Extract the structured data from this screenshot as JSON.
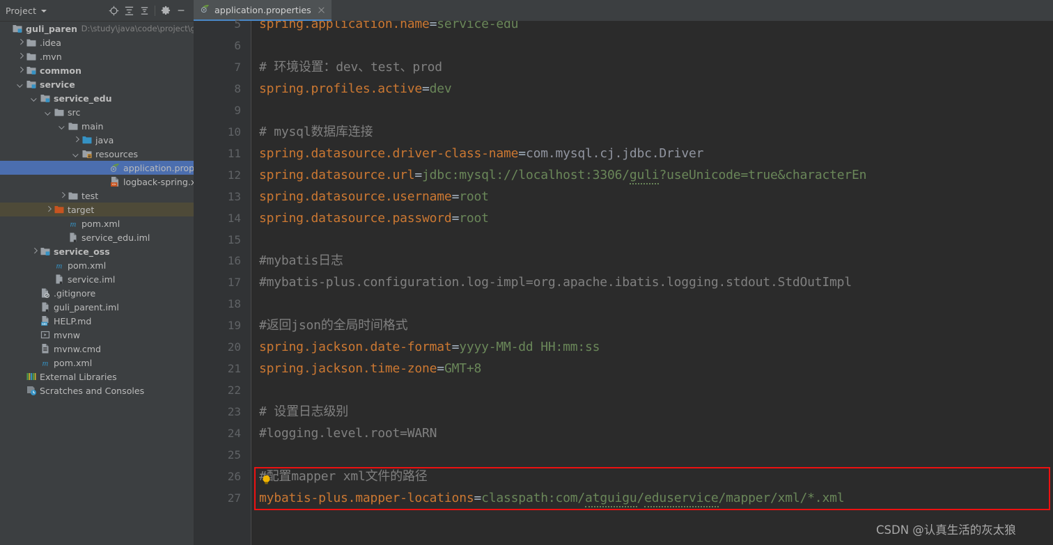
{
  "window": {
    "theme_colors": {
      "sidebar_bg": "#3c3f41",
      "editor_bg": "#2b2b2b",
      "gutter_bg": "#313335",
      "selection_blue": "#4b6eaf",
      "highlight_olive": "#4e4a38",
      "tab_active_bg": "#4e5254",
      "tab_underline": "#4a88c7",
      "key_orange": "#cc7832",
      "value_green": "#6a8759",
      "comment_gray": "#808080",
      "class_gray": "#9195a0",
      "annotation_red": "#ee1111"
    }
  },
  "project_panel": {
    "title": "Project",
    "toolbar_icons": [
      {
        "name": "scroll-from-source-icon",
        "glyph": "target"
      },
      {
        "name": "expand-all-icon",
        "glyph": "expand"
      },
      {
        "name": "collapse-all-icon",
        "glyph": "collapse"
      },
      {
        "name": "settings-gear-icon",
        "glyph": "gear"
      },
      {
        "name": "hide-panel-icon",
        "glyph": "minus"
      }
    ],
    "tree": [
      {
        "label": "guli_parent",
        "sub": "D:\\study\\java\\code\\project\\guli",
        "indent": 0,
        "arrow": "none",
        "icon": "module",
        "bold": true,
        "state": "none"
      },
      {
        "label": ".idea",
        "sub": "",
        "indent": 1,
        "arrow": "right",
        "icon": "folder",
        "bold": false,
        "state": "none"
      },
      {
        "label": ".mvn",
        "sub": "",
        "indent": 1,
        "arrow": "right",
        "icon": "folder",
        "bold": false,
        "state": "none"
      },
      {
        "label": "common",
        "sub": "",
        "indent": 1,
        "arrow": "right",
        "icon": "module",
        "bold": true,
        "state": "none"
      },
      {
        "label": "service",
        "sub": "",
        "indent": 1,
        "arrow": "down",
        "icon": "module",
        "bold": true,
        "state": "none"
      },
      {
        "label": "service_edu",
        "sub": "",
        "indent": 2,
        "arrow": "down",
        "icon": "module",
        "bold": true,
        "state": "none"
      },
      {
        "label": "src",
        "sub": "",
        "indent": 3,
        "arrow": "down",
        "icon": "folder",
        "bold": false,
        "state": "none"
      },
      {
        "label": "main",
        "sub": "",
        "indent": 4,
        "arrow": "down",
        "icon": "folder",
        "bold": false,
        "state": "none"
      },
      {
        "label": "java",
        "sub": "",
        "indent": 5,
        "arrow": "right",
        "icon": "sources",
        "bold": false,
        "state": "none"
      },
      {
        "label": "resources",
        "sub": "",
        "indent": 5,
        "arrow": "down",
        "icon": "resources",
        "bold": false,
        "state": "none"
      },
      {
        "label": "application.properties",
        "sub": "",
        "indent": 7,
        "arrow": "none",
        "icon": "spring",
        "bold": false,
        "state": "selected"
      },
      {
        "label": "logback-spring.xml",
        "sub": "",
        "indent": 7,
        "arrow": "none",
        "icon": "xml",
        "bold": false,
        "state": "none"
      },
      {
        "label": "test",
        "sub": "",
        "indent": 4,
        "arrow": "right",
        "icon": "folder",
        "bold": false,
        "state": "none"
      },
      {
        "label": "target",
        "sub": "",
        "indent": 3,
        "arrow": "right",
        "icon": "target",
        "bold": false,
        "state": "highlighted"
      },
      {
        "label": "pom.xml",
        "sub": "",
        "indent": 4,
        "arrow": "none",
        "icon": "maven",
        "bold": false,
        "state": "none"
      },
      {
        "label": "service_edu.iml",
        "sub": "",
        "indent": 4,
        "arrow": "none",
        "icon": "iml",
        "bold": false,
        "state": "none"
      },
      {
        "label": "service_oss",
        "sub": "",
        "indent": 2,
        "arrow": "right",
        "icon": "module",
        "bold": true,
        "state": "none"
      },
      {
        "label": "pom.xml",
        "sub": "",
        "indent": 3,
        "arrow": "none",
        "icon": "maven",
        "bold": false,
        "state": "none"
      },
      {
        "label": "service.iml",
        "sub": "",
        "indent": 3,
        "arrow": "none",
        "icon": "iml",
        "bold": false,
        "state": "none"
      },
      {
        "label": ".gitignore",
        "sub": "",
        "indent": 2,
        "arrow": "none",
        "icon": "gitignore",
        "bold": false,
        "state": "none"
      },
      {
        "label": "guli_parent.iml",
        "sub": "",
        "indent": 2,
        "arrow": "none",
        "icon": "iml",
        "bold": false,
        "state": "none"
      },
      {
        "label": "HELP.md",
        "sub": "",
        "indent": 2,
        "arrow": "none",
        "icon": "md",
        "bold": false,
        "state": "none"
      },
      {
        "label": "mvnw",
        "sub": "",
        "indent": 2,
        "arrow": "none",
        "icon": "script",
        "bold": false,
        "state": "none"
      },
      {
        "label": "mvnw.cmd",
        "sub": "",
        "indent": 2,
        "arrow": "none",
        "icon": "cmd",
        "bold": false,
        "state": "none"
      },
      {
        "label": "pom.xml",
        "sub": "",
        "indent": 2,
        "arrow": "none",
        "icon": "maven",
        "bold": false,
        "state": "none"
      },
      {
        "label": "External Libraries",
        "sub": "",
        "indent": 1,
        "arrow": "none",
        "icon": "libraries",
        "bold": false,
        "state": "none"
      },
      {
        "label": "Scratches and Consoles",
        "sub": "",
        "indent": 1,
        "arrow": "none",
        "icon": "scratches",
        "bold": false,
        "state": "none"
      }
    ]
  },
  "editor": {
    "tab": {
      "label": "application.properties",
      "icon": "spring-leaf-icon",
      "close_label": "×"
    },
    "first_visible_line": 5,
    "lines": [
      {
        "n": 5,
        "segments": [
          {
            "t": "spring.application.name",
            "c": "k"
          },
          {
            "t": "=",
            "c": "eq"
          },
          {
            "t": "service-edu",
            "c": "v"
          }
        ]
      },
      {
        "n": 6,
        "segments": []
      },
      {
        "n": 7,
        "segments": [
          {
            "t": "# 环境设置：dev、test、prod",
            "c": "cm"
          }
        ]
      },
      {
        "n": 8,
        "segments": [
          {
            "t": "spring.profiles.active",
            "c": "k"
          },
          {
            "t": "=",
            "c": "eq"
          },
          {
            "t": "dev",
            "c": "v"
          }
        ]
      },
      {
        "n": 9,
        "segments": []
      },
      {
        "n": 10,
        "segments": [
          {
            "t": "# mysql数据库连接",
            "c": "cm"
          }
        ]
      },
      {
        "n": 11,
        "segments": [
          {
            "t": "spring.datasource.driver-class-name",
            "c": "k"
          },
          {
            "t": "=",
            "c": "eq"
          },
          {
            "t": "com.mysql.cj.jdbc.Driver",
            "c": "cls"
          }
        ]
      },
      {
        "n": 12,
        "segments": [
          {
            "t": "spring.datasource.url",
            "c": "k"
          },
          {
            "t": "=",
            "c": "eq"
          },
          {
            "t": "jdbc:mysql://localhost:3306/",
            "c": "v"
          },
          {
            "t": "guli",
            "c": "v sq"
          },
          {
            "t": "?useUnicode=true&characterEn",
            "c": "v"
          }
        ]
      },
      {
        "n": 13,
        "segments": [
          {
            "t": "spring.datasource.username",
            "c": "k"
          },
          {
            "t": "=",
            "c": "eq"
          },
          {
            "t": "root",
            "c": "v"
          }
        ]
      },
      {
        "n": 14,
        "segments": [
          {
            "t": "spring.datasource.password",
            "c": "k"
          },
          {
            "t": "=",
            "c": "eq"
          },
          {
            "t": "root",
            "c": "v"
          }
        ]
      },
      {
        "n": 15,
        "segments": []
      },
      {
        "n": 16,
        "segments": [
          {
            "t": "#mybatis日志",
            "c": "cm"
          }
        ]
      },
      {
        "n": 17,
        "segments": [
          {
            "t": "#mybatis-plus.configuration.log-impl=org.apache.ibatis.logging.stdout.StdOutImpl",
            "c": "cm"
          }
        ]
      },
      {
        "n": 18,
        "segments": []
      },
      {
        "n": 19,
        "segments": [
          {
            "t": "#返回json的全局时间格式",
            "c": "cm"
          }
        ]
      },
      {
        "n": 20,
        "segments": [
          {
            "t": "spring.jackson.date-format",
            "c": "k"
          },
          {
            "t": "=",
            "c": "eq"
          },
          {
            "t": "yyyy-MM-dd HH:mm:ss",
            "c": "v"
          }
        ]
      },
      {
        "n": 21,
        "segments": [
          {
            "t": "spring.jackson.time-zone",
            "c": "k"
          },
          {
            "t": "=",
            "c": "eq"
          },
          {
            "t": "GMT+8",
            "c": "v"
          }
        ]
      },
      {
        "n": 22,
        "segments": []
      },
      {
        "n": 23,
        "segments": [
          {
            "t": "# 设置日志级别",
            "c": "cm"
          }
        ]
      },
      {
        "n": 24,
        "segments": [
          {
            "t": "#logging.level.root=WARN",
            "c": "cm"
          }
        ]
      },
      {
        "n": 25,
        "segments": []
      },
      {
        "n": 26,
        "segments": [
          {
            "t": "#配置mapper xml文件的路径",
            "c": "cm"
          }
        ]
      },
      {
        "n": 27,
        "segments": [
          {
            "t": "mybatis-plus.mapper-locations",
            "c": "k"
          },
          {
            "t": "=",
            "c": "eq"
          },
          {
            "t": "classpath:com/",
            "c": "v"
          },
          {
            "t": "atguigu",
            "c": "v sq"
          },
          {
            "t": "/",
            "c": "v"
          },
          {
            "t": "eduservice",
            "c": "v sq"
          },
          {
            "t": "/mapper/xml/*.xml",
            "c": "v"
          }
        ]
      }
    ],
    "annotation_box": {
      "starts_at_line": 26,
      "ends_at_line": 27
    },
    "intention_bulb": {
      "name": "intention-bulb-icon",
      "at_line": 26
    }
  },
  "watermark": {
    "text": "CSDN @认真生活的灰太狼"
  }
}
